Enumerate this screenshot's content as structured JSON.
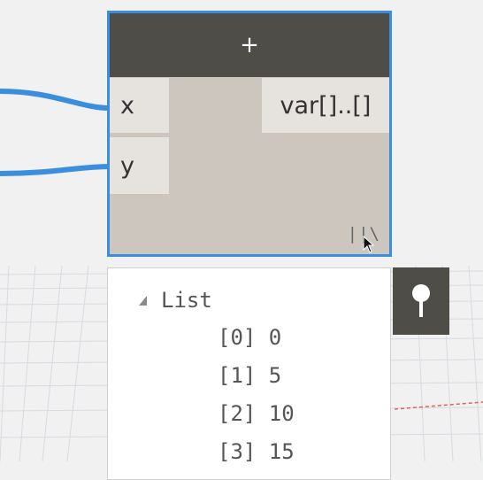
{
  "node": {
    "title": "+",
    "inputs": [
      "x",
      "y"
    ],
    "output": "var[]..[]",
    "lacing": "||\\"
  },
  "preview": {
    "header": "List",
    "items": [
      "[0] 0",
      "[1] 5",
      "[2] 10",
      "[3] 15"
    ]
  },
  "icons": [
    "expand-triangle-icon",
    "pin-icon",
    "mouse-cursor-icon"
  ],
  "colors": {
    "node_border": "#3b8ede",
    "node_header": "#4f4d48",
    "node_body": "#ccc6bf",
    "wire": "#3b8ede"
  }
}
